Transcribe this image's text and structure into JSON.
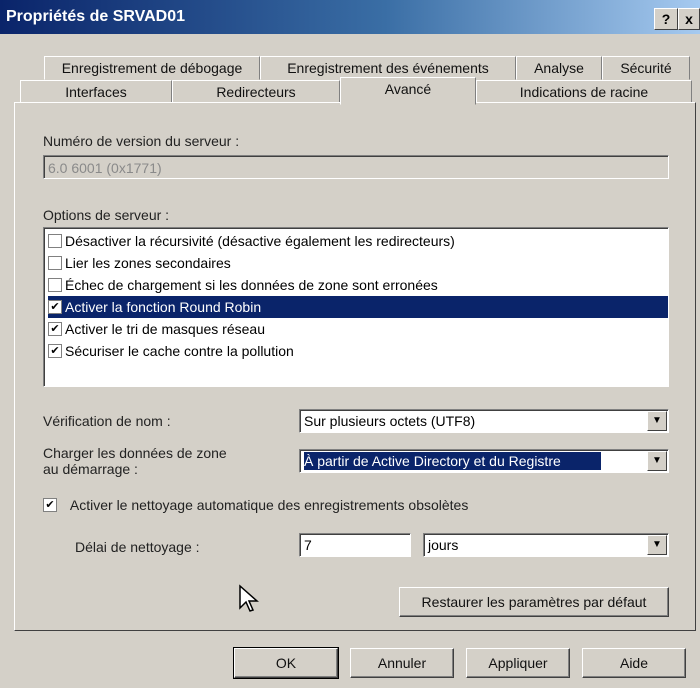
{
  "window": {
    "title": "Propriétés de SRVAD01",
    "help_label": "?",
    "close_label": "x"
  },
  "tabs": {
    "row1": [
      "Enregistrement de débogage",
      "Enregistrement des événements",
      "Analyse",
      "Sécurité"
    ],
    "row2": [
      "Interfaces",
      "Redirecteurs",
      "Avancé",
      "Indications de racine"
    ],
    "active": "Avancé"
  },
  "version": {
    "label": "Numéro de version du serveur :",
    "value": "6.0 6001 (0x1771)"
  },
  "server_options": {
    "label": "Options de serveur :",
    "items": [
      {
        "label": "Désactiver la récursivité (désactive également les redirecteurs)",
        "checked": false,
        "mark": ""
      },
      {
        "label": "Lier les zones secondaires",
        "checked": false,
        "mark": ""
      },
      {
        "label": "Échec de chargement si les données de zone sont erronées",
        "checked": false,
        "mark": ""
      },
      {
        "label": "Activer la fonction Round Robin",
        "checked": true,
        "mark": "✔"
      },
      {
        "label": "Activer le tri de masques réseau",
        "checked": true,
        "mark": "✔"
      },
      {
        "label": "Sécuriser le cache contre la pollution",
        "checked": true,
        "mark": "✔"
      }
    ],
    "selected_index": 3
  },
  "name_check": {
    "label": "Vérification de nom :",
    "value": "Sur plusieurs octets (UTF8)"
  },
  "load_zone": {
    "label_line1": "Charger les données de zone",
    "label_line2": "au démarrage :",
    "value": "À partir de Active Directory et du Registre"
  },
  "scavenging": {
    "checkbox_label": "Activer le nettoyage automatique des enregistrements obsolètes",
    "checked": true,
    "mark": "✔",
    "delay_label": "Délai de nettoyage :",
    "delay_value": "7",
    "unit": "jours"
  },
  "buttons": {
    "restore": "Restaurer les paramètres par défaut",
    "ok": "OK",
    "cancel": "Annuler",
    "apply": "Appliquer",
    "help": "Aide"
  },
  "icons": {
    "dropdown": "▼",
    "cursor": "arrow-cursor-icon"
  }
}
